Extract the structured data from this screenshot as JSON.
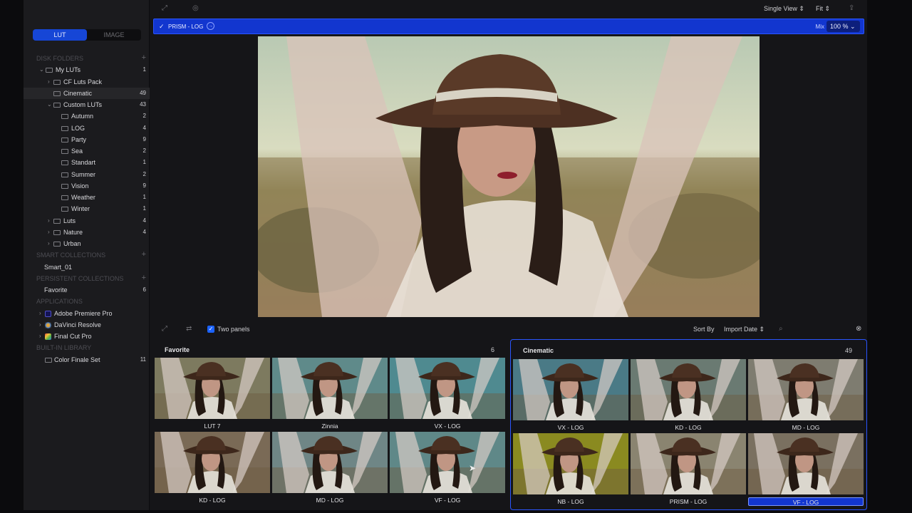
{
  "sidebar": {
    "tabs": {
      "lut": "LUT",
      "image": "IMAGE"
    },
    "sections": {
      "disk_folders": "DISK FOLDERS",
      "smart_collections": "SMART COLLECTIONS",
      "persistent_collections": "PERSISTENT COLLECTIONS",
      "applications": "APPLICATIONS",
      "builtin_library": "BUILT-IN LIBRARY"
    },
    "folders": [
      {
        "label": "My LUTs",
        "count": "1"
      },
      {
        "label": "CF Luts Pack",
        "count": ""
      },
      {
        "label": "Cinematic",
        "count": "49"
      },
      {
        "label": "Custom LUTs",
        "count": "43"
      },
      {
        "label": "Autumn",
        "count": "2"
      },
      {
        "label": "LOG",
        "count": "4"
      },
      {
        "label": "Party",
        "count": "9"
      },
      {
        "label": "Sea",
        "count": "2"
      },
      {
        "label": "Standart",
        "count": "1"
      },
      {
        "label": "Summer",
        "count": "2"
      },
      {
        "label": "Vision",
        "count": "9"
      },
      {
        "label": "Weather",
        "count": "1"
      },
      {
        "label": "Winter",
        "count": "1"
      },
      {
        "label": "Luts",
        "count": "4"
      },
      {
        "label": "Nature",
        "count": "4"
      },
      {
        "label": "Urban",
        "count": ""
      }
    ],
    "smart": [
      {
        "label": "Smart_01"
      }
    ],
    "persistent": [
      {
        "label": "Favorite",
        "count": "6"
      }
    ],
    "apps": [
      {
        "label": "Adobe Premiere Pro",
        "color": "#1a1a66"
      },
      {
        "label": "DaVinci Resolve",
        "color": "#d8892a"
      },
      {
        "label": "Final Cut Pro",
        "color": "#c2462e"
      }
    ],
    "builtin": [
      {
        "label": "Color Finale Set",
        "count": "11"
      }
    ]
  },
  "toolbar": {
    "view_mode": "Single View",
    "zoom_fit": "Fit",
    "lut_name": "PRISM - LOG",
    "mix_label": "Mix",
    "mix_value": "100 %"
  },
  "browser": {
    "two_panels_label": "Two panels",
    "sort_label": "Sort By",
    "sort_value": "Import Date",
    "left_panel": {
      "title": "Favorite",
      "count": "6",
      "items": [
        "LUT 7",
        "Zinnia",
        "VX - LOG",
        "KD - LOG",
        "MD - LOG",
        "VF - LOG"
      ]
    },
    "right_panel": {
      "title": "Cinematic",
      "count": "49",
      "items": [
        "VX - LOG",
        "KD - LOG",
        "MD - LOG",
        "NB - LOG",
        "PRISM - LOG",
        "VF - LOG"
      ],
      "selected": "VF - LOG"
    }
  }
}
